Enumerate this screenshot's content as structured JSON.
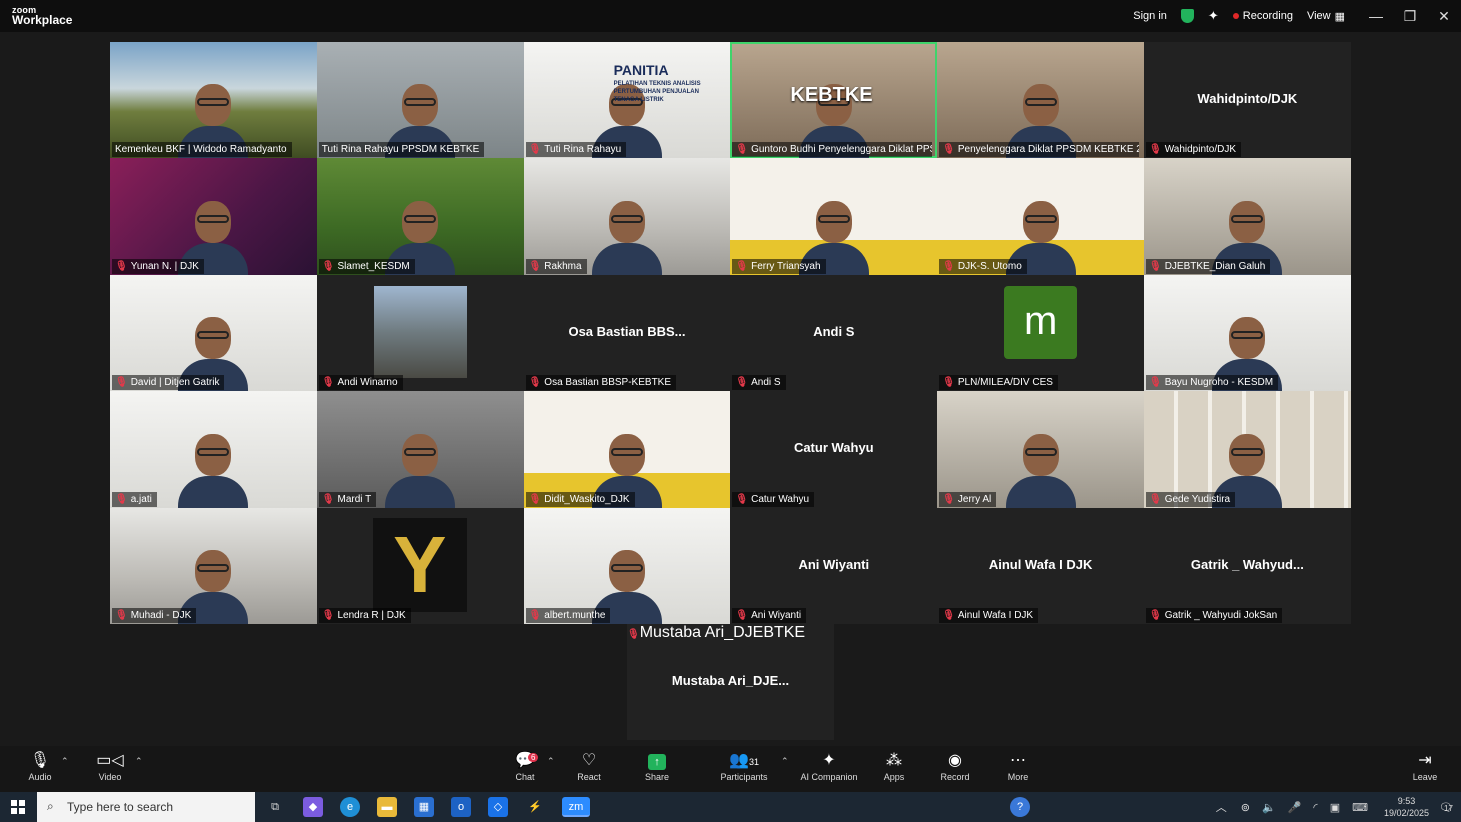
{
  "app": {
    "brand_top": "zoom",
    "brand_bottom": "Workplace"
  },
  "titlebar": {
    "sign_in": "Sign in",
    "recording": "Recording",
    "view": "View",
    "minimize": "—",
    "restore": "❐",
    "close": "✕"
  },
  "tiles": [
    {
      "name": "Kemenkeu BKF | Widodo Ramadyanto",
      "muted": false,
      "video": true,
      "bg": "sky-a"
    },
    {
      "name": "Tuti Rina Rahayu PPSDM KEBTKE",
      "muted": false,
      "video": true,
      "bg": "sky-b"
    },
    {
      "name": "Tuti Rina Rahayu",
      "muted": true,
      "video": true,
      "bg": "whitewall",
      "slide": "PANITIA",
      "slide_sub": "PELATIHAN TEKNIS ANALISIS PERTUMBUHAN PENJUALAN TENAGA LISTRIK"
    },
    {
      "name": "Guntoro Budhi Penyelenggara Diklat PPSDM...",
      "muted": true,
      "video": true,
      "bg": "brown",
      "active": true,
      "building": "KEBTKE"
    },
    {
      "name": "Penyelenggara Diklat PPSDM KEBTKE 2",
      "muted": true,
      "video": true,
      "bg": "brown"
    },
    {
      "name": "Wahidpinto/DJK",
      "muted": true,
      "video": false,
      "center": "Wahidpinto/DJK"
    },
    {
      "name": "Yunan N. | DJK",
      "muted": true,
      "video": true,
      "bg": "purple"
    },
    {
      "name": "Slamet_KESDM",
      "muted": true,
      "video": true,
      "bg": "green"
    },
    {
      "name": "Rakhma",
      "muted": true,
      "video": true,
      "bg": "office"
    },
    {
      "name": "Ferry Triansyah",
      "muted": true,
      "video": true,
      "bg": "yellowbg"
    },
    {
      "name": "DJK-S. Utomo",
      "muted": true,
      "video": true,
      "bg": "yellowbg"
    },
    {
      "name": "DJEBTKE_Dian Galuh",
      "muted": true,
      "video": true,
      "bg": "room"
    },
    {
      "name": "David | Ditjen Gatrik",
      "muted": true,
      "video": true,
      "bg": "whitewall"
    },
    {
      "name": "Andi Winarno",
      "muted": true,
      "video": false,
      "photo": true
    },
    {
      "name": "Osa Bastian BBSP-KEBTKE",
      "muted": true,
      "video": false,
      "center": "Osa Bastian BBS..."
    },
    {
      "name": "Andi S",
      "muted": true,
      "video": false,
      "center": "Andi S"
    },
    {
      "name": "PLN/MILEA/DIV CES",
      "muted": true,
      "video": false,
      "avatar": "m"
    },
    {
      "name": "Bayu Nugroho - KESDM",
      "muted": true,
      "video": true,
      "bg": "whitewall"
    },
    {
      "name": "a.jati",
      "muted": true,
      "video": true,
      "bg": "whitewall"
    },
    {
      "name": "Mardi T",
      "muted": true,
      "video": true,
      "bg": "grey"
    },
    {
      "name": "Didit_Waskito_DJK",
      "muted": true,
      "video": true,
      "bg": "yellowbg"
    },
    {
      "name": "Catur Wahyu",
      "muted": true,
      "video": false,
      "center": "Catur Wahyu"
    },
    {
      "name": "Jerry Al",
      "muted": true,
      "video": true,
      "bg": "room"
    },
    {
      "name": "Gede Yudistira",
      "muted": true,
      "video": true,
      "bg": "shelf"
    },
    {
      "name": "Muhadi - DJK",
      "muted": true,
      "video": true,
      "bg": "office"
    },
    {
      "name": "Lendra R | DJK",
      "muted": true,
      "video": false,
      "yavatar": "Y"
    },
    {
      "name": "albert.munthe",
      "muted": true,
      "video": true,
      "bg": "whitewall"
    },
    {
      "name": "Ani Wiyanti",
      "muted": true,
      "video": false,
      "center": "Ani Wiyanti"
    },
    {
      "name": "Ainul Wafa I DJK",
      "muted": true,
      "video": false,
      "center": "Ainul Wafa I DJK"
    },
    {
      "name": "Gatrik _ Wahyudi JokSan",
      "muted": true,
      "video": false,
      "center": "Gatrik _ Wahyud..."
    }
  ],
  "lone_tile": {
    "name": "Mustaba Ari_DJEBTKE",
    "center": "Mustaba  Ari_DJE..."
  },
  "toolbar": {
    "audio": "Audio",
    "video": "Video",
    "chat": "Chat",
    "chat_badge": "6",
    "react": "React",
    "share": "Share",
    "participants": "Participants",
    "participants_count": "31",
    "ai_companion": "AI Companion",
    "apps": "Apps",
    "record": "Record",
    "more": "More",
    "leave": "Leave"
  },
  "taskbar": {
    "search_placeholder": "Type here to search",
    "time": "9:53",
    "date": "19/02/2025",
    "notification_count": "17"
  }
}
